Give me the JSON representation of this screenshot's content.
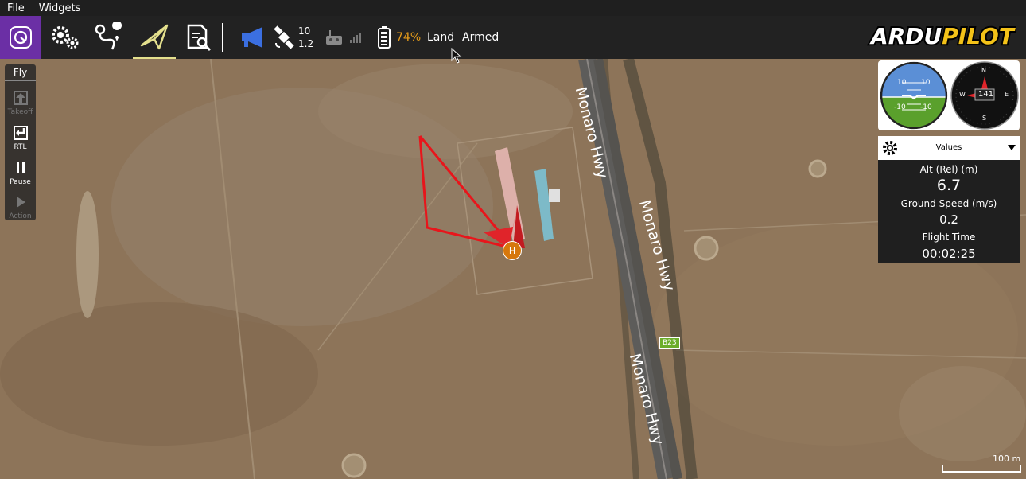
{
  "menu": {
    "file": "File",
    "widgets": "Widgets"
  },
  "toolbar": {
    "satellites": "10",
    "hdop": "1.2",
    "battery": "74%",
    "mode": "Land",
    "armed": "Armed",
    "brand": "ARDUPILOT"
  },
  "fly": {
    "title": "Fly",
    "takeoff": "Takeoff",
    "rtl": "RTL",
    "pause": "Pause",
    "action": "Action"
  },
  "instruments": {
    "pitch_up": "10",
    "pitch_up_r": "10",
    "pitch_down": "-10",
    "pitch_down_r": "-10",
    "heading": "141",
    "n": "N",
    "e": "E",
    "s": "S",
    "w": "W"
  },
  "values": {
    "header": "Values",
    "alt_label": "Alt (Rel) (m)",
    "alt_value": "6.7",
    "gs_label": "Ground Speed (m/s)",
    "gs_value": "0.2",
    "ft_label": "Flight Time",
    "ft_value": "00:02:25"
  },
  "map": {
    "road1": "Monaro Hwy",
    "road2": "Monaro Hwy",
    "road3": "Monaro Hwy",
    "route": "B23",
    "home": "H",
    "scale": "100 m"
  },
  "colors": {
    "accent": "#6b2fa5",
    "battery": "#e59b1a",
    "flight_path": "#e8151b",
    "megaphone": "#3b6fe0"
  }
}
